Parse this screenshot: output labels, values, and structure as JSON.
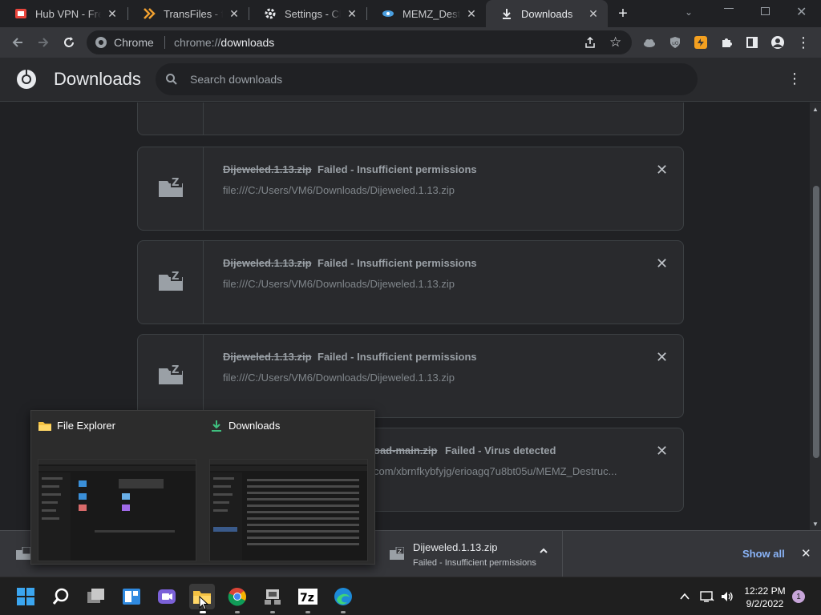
{
  "tabs": [
    {
      "title": "Hub VPN - Free",
      "icon": "hub-vpn-icon",
      "active": false
    },
    {
      "title": "TransFiles - free",
      "icon": "transfiles-icon",
      "active": false
    },
    {
      "title": "Settings - Check",
      "icon": "gear-icon",
      "active": false
    },
    {
      "title": "MEMZ_Destruct",
      "icon": "web-icon",
      "active": false
    },
    {
      "title": "Downloads",
      "icon": "download-icon",
      "active": true
    }
  ],
  "toolbar": {
    "site_label": "Chrome",
    "url_scheme": "chrome://",
    "url_host": "downloads"
  },
  "header": {
    "title": "Downloads",
    "search_placeholder": "Search downloads"
  },
  "downloads": [
    {
      "filename": "Dijeweled.1.13.zip",
      "status": "Failed - Insufficient permissions",
      "url": "file:///C:/Users/VM6/Downloads/Dijeweled.1.13.zip"
    },
    {
      "filename": "Dijeweled.1.13.zip",
      "status": "Failed - Insufficient permissions",
      "url": "file:///C:/Users/VM6/Downloads/Dijeweled.1.13.zip"
    },
    {
      "filename": "Dijeweled.1.13.zip",
      "status": "Failed - Insufficient permissions",
      "url": "file:///C:/Users/VM6/Downloads/Dijeweled.1.13.zip"
    },
    {
      "filename": "oad-main.zip",
      "status": "Failed - Virus detected",
      "url": "com/xbrnfkybfyjg/erioagq7u8bt05u/MEMZ_Destruc..."
    }
  ],
  "shelf": {
    "filename": "Dijeweled.1.13.zip",
    "status": "Failed - Insufficient permissions",
    "show_all": "Show all"
  },
  "thumbnails": [
    {
      "title": "File Explorer"
    },
    {
      "title": "Downloads"
    }
  ],
  "taskbar": {
    "time": "12:22 PM",
    "date": "9/2/2022",
    "notifications": "1"
  },
  "colors": {
    "accent_blue": "#8ab4f8",
    "vpn_red": "#e8453c",
    "transfiles_orange": "#f0a030",
    "extension_orange": "#f3a020"
  }
}
